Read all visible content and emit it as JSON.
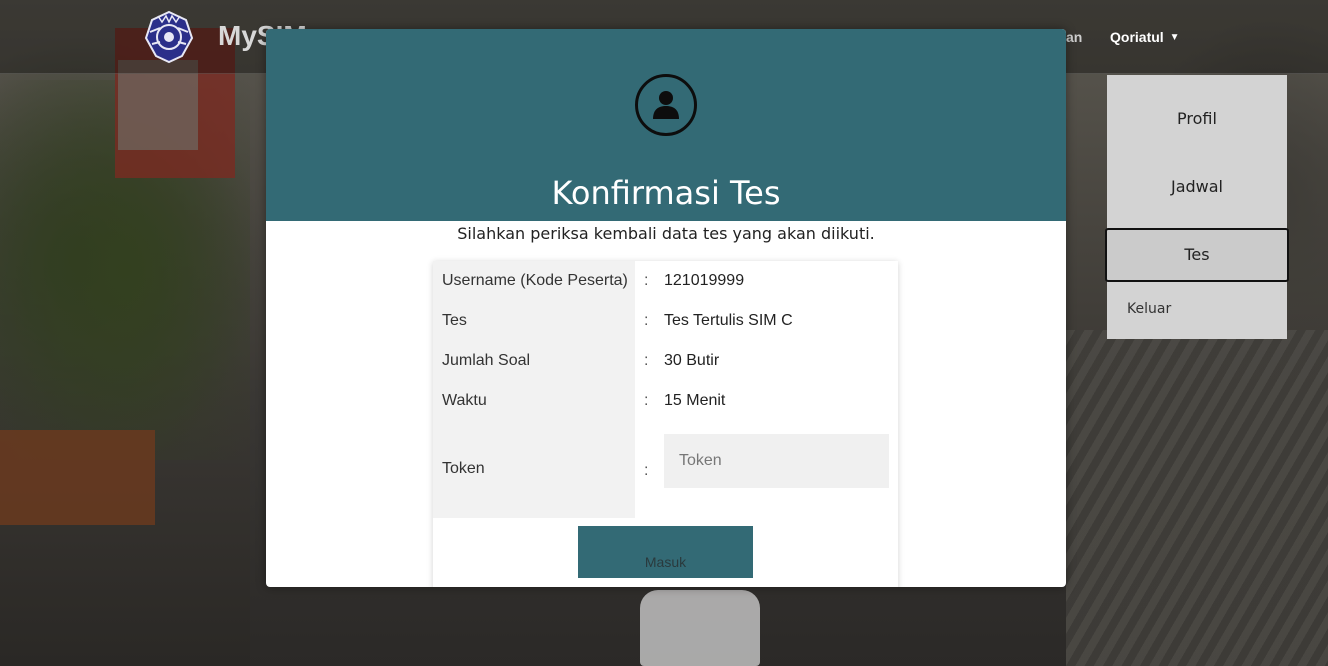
{
  "navbar": {
    "brand": "MySIM",
    "partial_link": "an",
    "user_name": "Qoriatul"
  },
  "dropdown": {
    "items": [
      {
        "label": "Profil"
      },
      {
        "label": "Jadwal"
      },
      {
        "label": "Tes",
        "active": true
      },
      {
        "label": "Keluar"
      }
    ]
  },
  "modal": {
    "title": "Konfirmasi Tes",
    "subtitle": "Silahkan periksa kembali data tes yang akan diikuti.",
    "rows": [
      {
        "label": "Username (Kode Peserta)",
        "value": "121019999"
      },
      {
        "label": "Tes",
        "value": "Tes Tertulis SIM C"
      },
      {
        "label": "Jumlah Soal",
        "value": "30 Butir"
      },
      {
        "label": "Waktu",
        "value": "15 Menit"
      },
      {
        "label": "Token",
        "value": ""
      }
    ],
    "separator": ":",
    "token_placeholder": "Token",
    "submit_label": "Masuk"
  },
  "colors": {
    "header_teal": "#336a75",
    "dropdown_bg": "#d3d3d3",
    "label_col_bg": "#f2f2f2"
  }
}
